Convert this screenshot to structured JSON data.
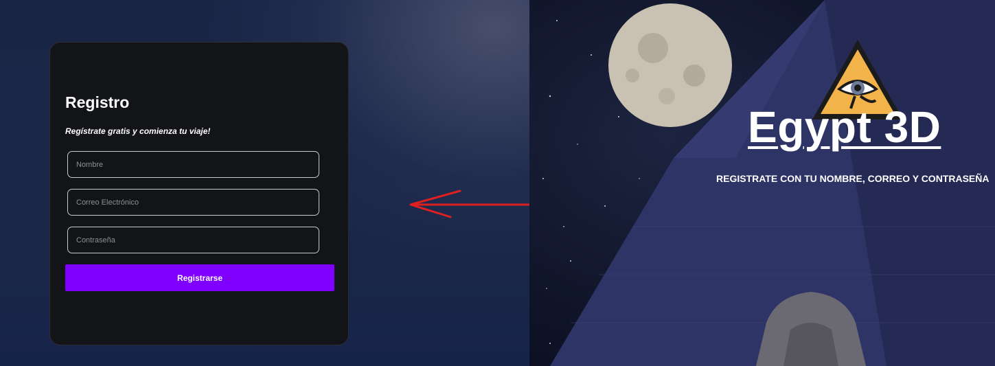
{
  "form": {
    "title": "Registro",
    "subtitle": "Regístrate gratis y comienza tu viaje!",
    "name_placeholder": "Nombre",
    "email_placeholder": "Correo Electrónico",
    "password_placeholder": "Contraseña",
    "submit_label": "Registrarse"
  },
  "hero": {
    "title": "Egypt 3D",
    "subtitle": "REGISTRATE CON TU NOMBRE, CORREO Y CONTRASEÑA",
    "logo_icon": "eye-of-horus-triangle-icon"
  },
  "decor": {
    "arrow_icon": "arrow-left-icon",
    "arrow_color": "#e02020",
    "accent_color": "#7f00ff"
  }
}
